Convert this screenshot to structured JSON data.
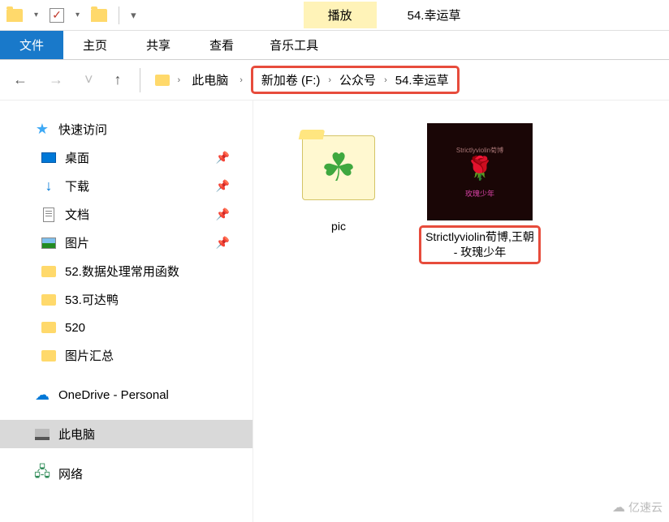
{
  "window": {
    "title": "54.幸运草"
  },
  "play_tab": {
    "label": "播放",
    "context_label": "音乐工具"
  },
  "ribbon": {
    "file": "文件",
    "tabs": [
      "主页",
      "共享",
      "查看"
    ]
  },
  "nav": {
    "back": "←",
    "forward": "→",
    "up": "↑"
  },
  "breadcrumb": {
    "root": "此电脑",
    "highlighted": [
      "新加卷 (F:)",
      "公众号",
      "54.幸运草"
    ]
  },
  "sidebar": {
    "quick_access": "快速访问",
    "quick_items": [
      {
        "label": "桌面",
        "icon": "desktop",
        "pinned": true
      },
      {
        "label": "下载",
        "icon": "download",
        "pinned": true
      },
      {
        "label": "文档",
        "icon": "doc",
        "pinned": true
      },
      {
        "label": "图片",
        "icon": "image",
        "pinned": true
      },
      {
        "label": "52.数据处理常用函数",
        "icon": "folder",
        "pinned": false
      },
      {
        "label": "53.可达鸭",
        "icon": "folder",
        "pinned": false
      },
      {
        "label": "520",
        "icon": "folder",
        "pinned": false
      },
      {
        "label": "图片汇总",
        "icon": "folder",
        "pinned": false
      }
    ],
    "onedrive": "OneDrive - Personal",
    "this_pc": "此电脑",
    "network": "网络"
  },
  "content": {
    "items": [
      {
        "name": "pic",
        "type": "folder"
      },
      {
        "name": "Strictlyviolin荀博,王朝 - 玫瑰少年",
        "type": "music",
        "highlighted": true,
        "cover_text": "玫瑰少年"
      }
    ]
  },
  "watermark": "亿速云"
}
